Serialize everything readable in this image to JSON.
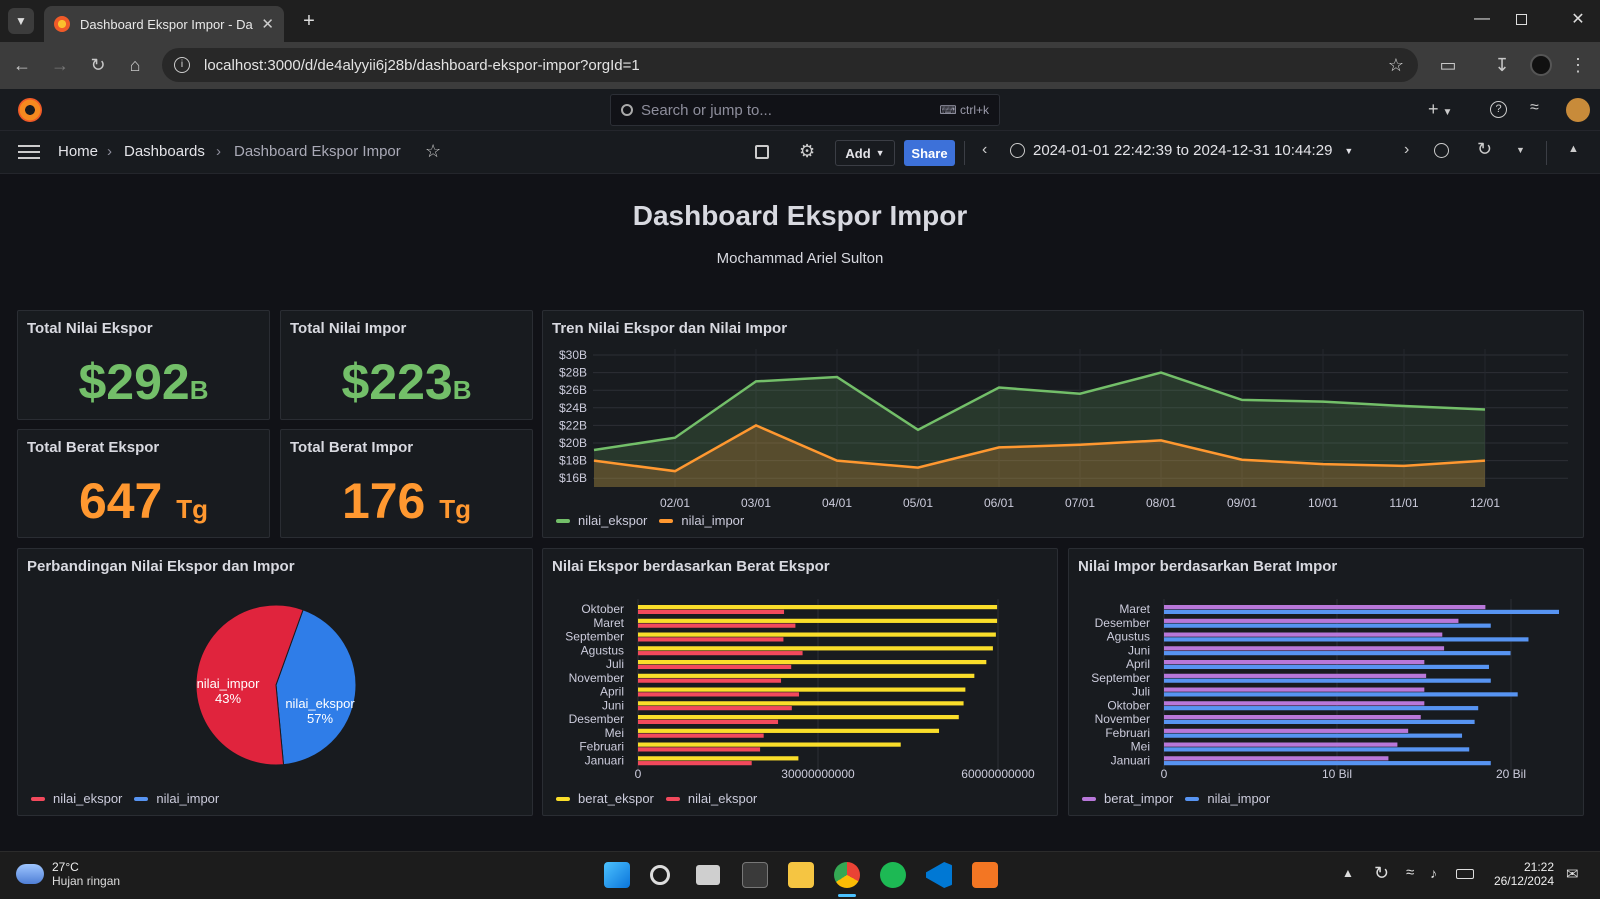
{
  "browser": {
    "tab_title": "Dashboard Ekspor Impor - Dasl",
    "url": "localhost:3000/d/de4alyyii6j28b/dashboard-ekspor-impor?orgId=1"
  },
  "grafana": {
    "search_placeholder": "Search or jump to...",
    "search_shortcut": "ctrl+k",
    "breadcrumb": [
      "Home",
      "Dashboards",
      "Dashboard Ekspor Impor"
    ],
    "add_label": "Add",
    "share_label": "Share",
    "time_range": "2024-01-01 22:42:39 to 2024-12-31 10:44:29"
  },
  "dashboard": {
    "title": "Dashboard Ekspor Impor",
    "subtitle": "Mochammad Ariel Sulton"
  },
  "stats": [
    {
      "title": "Total Nilai Ekspor",
      "value": "$292",
      "unit": "B",
      "color": "#73bf69"
    },
    {
      "title": "Total Nilai Impor",
      "value": "$223",
      "unit": "B",
      "color": "#73bf69"
    },
    {
      "title": "Total Berat Ekspor",
      "value": "647",
      "unit": "Tg",
      "color": "#ff9830"
    },
    {
      "title": "Total Berat Impor",
      "value": "176",
      "unit": "Tg",
      "color": "#ff9830"
    }
  ],
  "trend": {
    "title": "Tren Nilai Ekspor dan Nilai Impor",
    "legend": [
      "nilai_ekspor",
      "nilai_impor"
    ]
  },
  "pie": {
    "title": "Perbandingan Nilai Ekspor dan Impor",
    "legend": [
      "nilai_ekspor",
      "nilai_impor"
    ],
    "label_impor": "nilai_impor",
    "pct_impor": "43%",
    "label_ekspor": "nilai_ekspor",
    "pct_ekspor": "57%"
  },
  "bar_ekspor": {
    "title": "Nilai Ekspor berdasarkan Berat Ekspor",
    "legend": [
      "berat_ekspor",
      "nilai_ekspor"
    ]
  },
  "bar_impor": {
    "title": "Nilai Impor berdasarkan Berat Impor",
    "legend": [
      "berat_impor",
      "nilai_impor"
    ]
  },
  "taskbar": {
    "temp": "27°C",
    "weather": "Hujan ringan",
    "time": "21:22",
    "date": "26/12/2024"
  },
  "chart_data": [
    {
      "type": "area",
      "title": "Tren Nilai Ekspor dan Nilai Impor",
      "x": [
        "01/01",
        "02/01",
        "03/01",
        "04/01",
        "05/01",
        "06/01",
        "07/01",
        "08/01",
        "09/01",
        "10/01",
        "11/01",
        "12/01"
      ],
      "x_tick_labels": [
        "02/01",
        "03/01",
        "04/01",
        "05/01",
        "06/01",
        "07/01",
        "08/01",
        "09/01",
        "10/01",
        "11/01",
        "12/01"
      ],
      "y_tick_labels": [
        "$16B",
        "$18B",
        "$20B",
        "$22B",
        "$24B",
        "$26B",
        "$28B",
        "$30B"
      ],
      "ylim": [
        15,
        30
      ],
      "series": [
        {
          "name": "nilai_ekspor",
          "color": "#73bf69",
          "values": [
            19.2,
            20.6,
            27.0,
            27.5,
            21.5,
            26.3,
            25.6,
            28.0,
            24.9,
            24.7,
            24.2,
            23.8
          ]
        },
        {
          "name": "nilai_impor",
          "color": "#ff9830",
          "values": [
            18.0,
            16.8,
            22.0,
            18.0,
            17.2,
            19.5,
            19.8,
            20.3,
            18.1,
            17.6,
            17.4,
            18.0
          ]
        }
      ]
    },
    {
      "type": "pie",
      "title": "Perbandingan Nilai Ekspor dan Impor",
      "series": [
        {
          "name": "nilai_ekspor",
          "color": "#f2495c",
          "percent": 57
        },
        {
          "name": "nilai_impor",
          "color": "#5794f2",
          "percent": 43
        }
      ]
    },
    {
      "type": "bar",
      "title": "Nilai Ekspor berdasarkan Berat Ekspor",
      "categories": [
        "Oktober",
        "Maret",
        "September",
        "Agustus",
        "Juli",
        "November",
        "April",
        "Juni",
        "Desember",
        "Mei",
        "Februari",
        "Januari"
      ],
      "x_tick_labels": [
        "0",
        "30000000000",
        "60000000000"
      ],
      "xlim": [
        0,
        66000000000
      ],
      "series": [
        {
          "name": "berat_ekspor",
          "color": "#fade2a",
          "values": [
            60000000000,
            60000000000,
            59800000000,
            59300000000,
            58200000000,
            56200000000,
            54700000000,
            54400000000,
            53600000000,
            50300000000,
            43900000000,
            26800000000
          ]
        },
        {
          "name": "nilai_ekspor",
          "color": "#f2495c",
          "values": [
            24400000000,
            26300000000,
            24300000000,
            27500000000,
            25600000000,
            23900000000,
            26900000000,
            25700000000,
            23400000000,
            21000000000,
            20400000000,
            19000000000
          ]
        }
      ]
    },
    {
      "type": "bar",
      "title": "Nilai Impor berdasarkan Berat Impor",
      "categories": [
        "Maret",
        "Desember",
        "Agustus",
        "Juni",
        "April",
        "September",
        "Juli",
        "Oktober",
        "November",
        "Februari",
        "Mei",
        "Januari"
      ],
      "x_tick_labels": [
        "0",
        "10 Bil",
        "20 Bil"
      ],
      "xlim": [
        0,
        22000000000
      ],
      "series": [
        {
          "name": "berat_impor",
          "color": "#b877d9",
          "values": [
            17900000000,
            16400000000,
            15500000000,
            15600000000,
            14500000000,
            14600000000,
            14500000000,
            14500000000,
            14300000000,
            13600000000,
            13000000000,
            12500000000
          ]
        },
        {
          "name": "nilai_impor",
          "color": "#5794f2",
          "values": [
            22000000000,
            18200000000,
            20300000000,
            19300000000,
            18100000000,
            18200000000,
            19700000000,
            17500000000,
            17300000000,
            16600000000,
            17000000000,
            18200000000
          ]
        }
      ]
    }
  ]
}
